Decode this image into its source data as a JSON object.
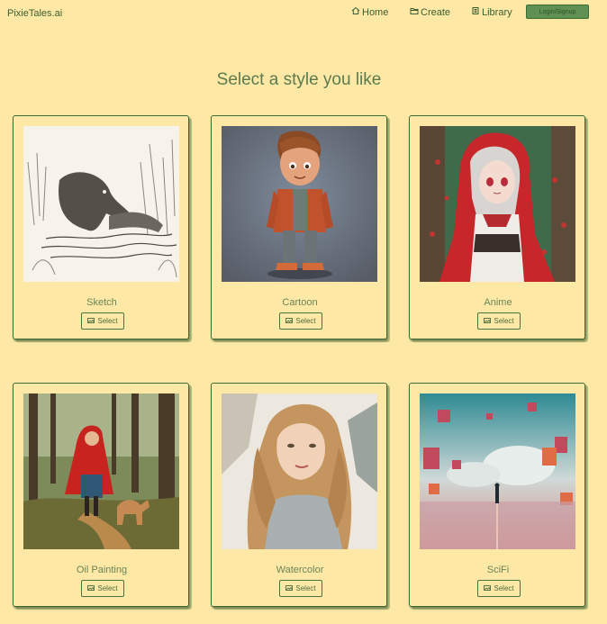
{
  "header": {
    "brand": "PixieTales.ai",
    "nav": [
      {
        "label": "Home",
        "icon": "home-icon"
      },
      {
        "label": "Create",
        "icon": "folder-icon"
      },
      {
        "label": "Library",
        "icon": "book-icon"
      }
    ],
    "login_label": "Login/Signup"
  },
  "main": {
    "title": "Select a style you like",
    "select_label": "Select",
    "styles": [
      {
        "label": "Sketch"
      },
      {
        "label": "Cartoon"
      },
      {
        "label": "Anime"
      },
      {
        "label": "Oil Painting"
      },
      {
        "label": "Watercolor"
      },
      {
        "label": "SciFi"
      }
    ]
  },
  "colors": {
    "background": "#fde9a5",
    "accent": "#5f9152",
    "text": "#4b6a3e"
  }
}
